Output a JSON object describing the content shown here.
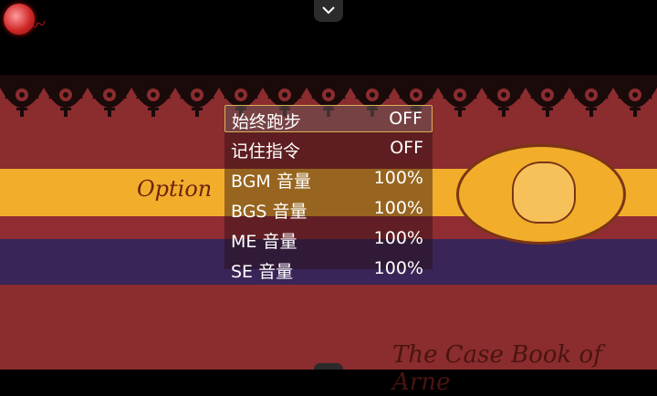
{
  "topbar": {
    "icon": "blood-moon-icon",
    "toggle_icon": "chevron-down-icon"
  },
  "scene": {
    "option_title": "Option",
    "game_title": "The Case Book of Arne",
    "colors": {
      "red": "#8b2c2f",
      "yellow": "#f2ad2b",
      "purple": "#3a2558",
      "text": "#ffffff",
      "highlight": "#d7b25a"
    }
  },
  "options": [
    {
      "label": "始终跑步",
      "value": "OFF",
      "selected": true
    },
    {
      "label": "记住指令",
      "value": "OFF",
      "selected": false
    },
    {
      "label": "BGM 音量",
      "value": "100%",
      "selected": false
    },
    {
      "label": "BGS 音量",
      "value": "100%",
      "selected": false
    },
    {
      "label": "ME 音量",
      "value": "100%",
      "selected": false
    },
    {
      "label": "SE 音量",
      "value": "100%",
      "selected": false
    }
  ]
}
